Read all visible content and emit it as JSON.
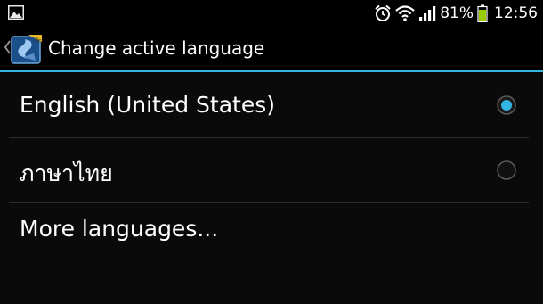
{
  "status_bar": {
    "left_icon": "image-notification-icon",
    "icons": [
      "alarm-clock-icon",
      "wifi-icon",
      "signal-icon",
      "battery-icon"
    ],
    "battery_percent_text": "81%",
    "time": "12:56"
  },
  "action_bar": {
    "up_icon": "up-caret-icon",
    "app_icon": "swiftkey-app-icon",
    "title": "Change active language"
  },
  "languages": [
    {
      "label": "English (United States)",
      "selected": true
    },
    {
      "label": "ภาษาไทย",
      "selected": false
    }
  ],
  "more_languages_label": "More languages...",
  "colors": {
    "accent": "#33b5e5",
    "background": "#0a0a0a",
    "battery": "#99cc00"
  }
}
